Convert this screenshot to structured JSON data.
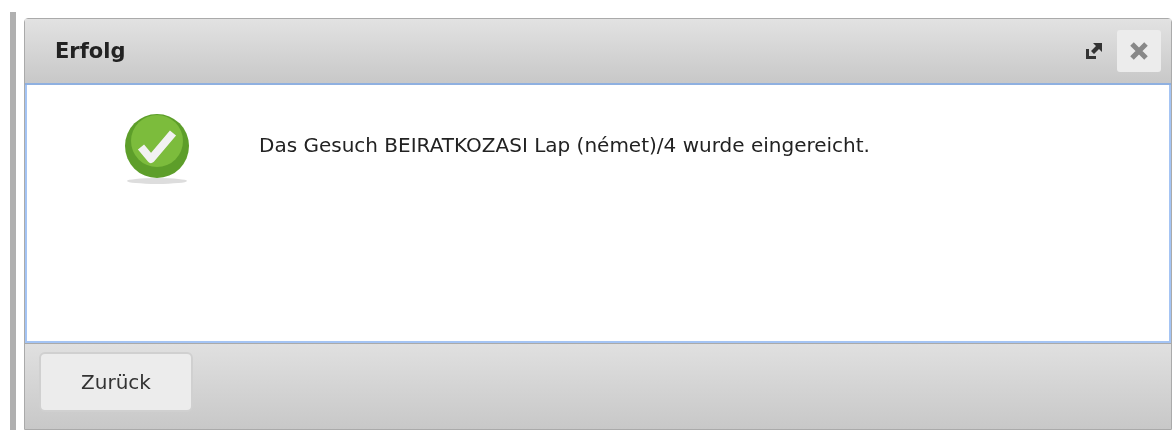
{
  "dialog": {
    "title": "Erfolg",
    "message": "Das Gesuch BEIRATKOZASI Lap (német)/4 wurde eingereicht.",
    "buttons": [
      "Zurück"
    ]
  }
}
